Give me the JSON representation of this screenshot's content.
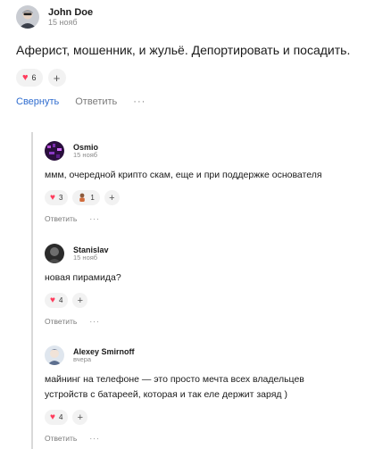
{
  "main_comment": {
    "author": "John Doe",
    "date": "15 нояб",
    "text": "Аферист, мошенник, и жульё. Депортировать и посадить.",
    "reactions": [
      {
        "icon": "heart-icon",
        "count": "6"
      }
    ],
    "collapse_label": "Свернуть",
    "reply_label": "Ответить",
    "more_label": "···"
  },
  "replies": [
    {
      "author": "Osmio",
      "date": "15 нояб",
      "text": "ммм, очередной крипто скам, еще и при поддержке основателя",
      "reactions": [
        {
          "icon": "heart-icon",
          "count": "3"
        },
        {
          "icon": "person-emoji-icon",
          "count": "1"
        }
      ],
      "reply_label": "Ответить",
      "more_label": "···"
    },
    {
      "author": "Stanislav",
      "date": "15 нояб",
      "text": "новая пирамида?",
      "reactions": [
        {
          "icon": "heart-icon",
          "count": "4"
        }
      ],
      "reply_label": "Ответить",
      "more_label": "···"
    },
    {
      "author": "Alexey Smirnoff",
      "date": "вчера",
      "text_lines": [
        "майнинг на телефоне — это просто мечта всех владельцев",
        "устройств с батареей, которая и так еле держит заряд )"
      ],
      "reactions": [
        {
          "icon": "heart-icon",
          "count": "4"
        }
      ],
      "reply_label": "Ответить",
      "more_label": "···"
    }
  ],
  "add_reaction_symbol": "+",
  "colors": {
    "link": "#2f6ccf",
    "heart": "#ff3b5c",
    "thread_line": "#d9d9d9",
    "pill_bg": "#f2f2f2"
  }
}
